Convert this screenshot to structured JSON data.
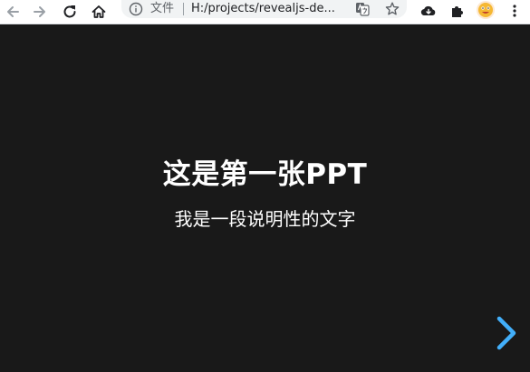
{
  "browser": {
    "scheme_label": "文件",
    "url": "H:/projects/revealjs-de...",
    "icons": {
      "back": "back-arrow-icon",
      "forward": "forward-arrow-icon",
      "reload": "reload-icon",
      "home": "home-icon",
      "info": "info-icon",
      "translate": "translate-icon",
      "bookmark": "star-icon",
      "cloud": "cloud-download-icon",
      "extensions": "puzzle-icon",
      "profile": "avatar-emoji"
    }
  },
  "slide": {
    "title": "这是第一张PPT",
    "subtitle": "我是一段说明性的文字",
    "background_color": "#191919",
    "text_color": "#ffffff",
    "control_color": "#42affa",
    "controls": {
      "next_icon": "chevron-right-icon"
    }
  }
}
